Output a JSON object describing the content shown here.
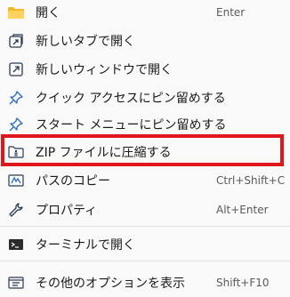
{
  "menu": {
    "items": [
      {
        "label": "開く",
        "shortcut": "Enter",
        "icon": "folder-icon"
      },
      {
        "label": "新しいタブで開く",
        "shortcut": "",
        "icon": "new-tab-icon"
      },
      {
        "label": "新しいウィンドウで開く",
        "shortcut": "",
        "icon": "new-window-icon"
      },
      {
        "label": "クイック アクセスにピン留めする",
        "shortcut": "",
        "icon": "pin-icon"
      },
      {
        "label": "スタート メニューにピン留めする",
        "shortcut": "",
        "icon": "pin-icon"
      },
      {
        "label": "ZIP ファイルに圧縮する",
        "shortcut": "",
        "icon": "zip-icon"
      },
      {
        "label": "パスのコピー",
        "shortcut": "Ctrl+Shift+C",
        "icon": "copy-path-icon"
      },
      {
        "label": "プロパティ",
        "shortcut": "Alt+Enter",
        "icon": "wrench-icon"
      },
      {
        "label": "ターミナルで開く",
        "shortcut": "",
        "icon": "terminal-icon"
      },
      {
        "label": "その他のオプションを表示",
        "shortcut": "Shift+F10",
        "icon": "more-options-icon"
      }
    ]
  },
  "colors": {
    "highlight_border": "#e0161d",
    "folder_accent": "#f5b829",
    "icon_blue": "#2a6bbf"
  }
}
